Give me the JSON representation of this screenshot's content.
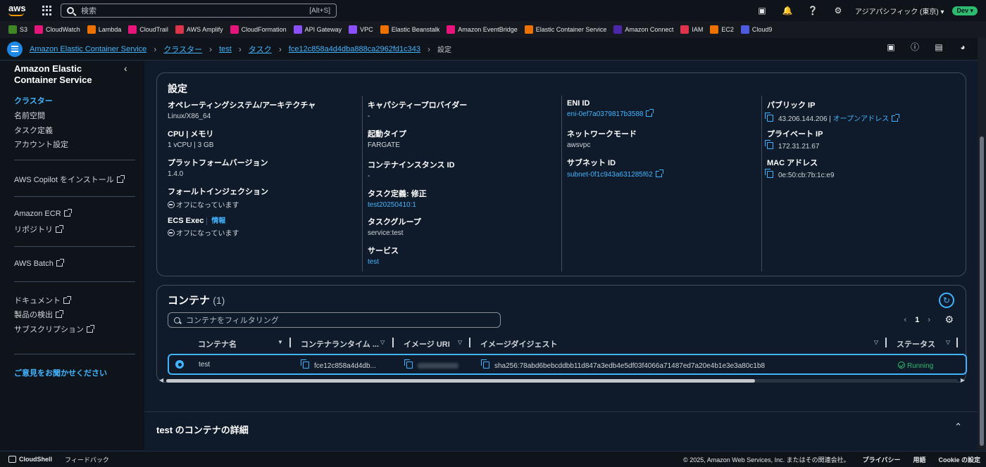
{
  "topnav": {
    "search_placeholder": "検索",
    "search_shortcut": "[Alt+S]",
    "region": "アジアパシフィック (東京) ▾",
    "account_badge": "Dev ▾"
  },
  "favorites": [
    {
      "label": "S3",
      "color": "#3f8624"
    },
    {
      "label": "CloudWatch",
      "color": "#e7157b"
    },
    {
      "label": "Lambda",
      "color": "#ed7100"
    },
    {
      "label": "CloudTrail",
      "color": "#e7157b"
    },
    {
      "label": "AWS Amplify",
      "color": "#dd344c"
    },
    {
      "label": "CloudFormation",
      "color": "#e7157b"
    },
    {
      "label": "API Gateway",
      "color": "#8c4fff"
    },
    {
      "label": "VPC",
      "color": "#8c4fff"
    },
    {
      "label": "Elastic Beanstalk",
      "color": "#ed7100"
    },
    {
      "label": "Amazon EventBridge",
      "color": "#e7157b"
    },
    {
      "label": "Elastic Container Service",
      "color": "#ed7100"
    },
    {
      "label": "Amazon Connect",
      "color": "#4d27aa"
    },
    {
      "label": "IAM",
      "color": "#dd344c"
    },
    {
      "label": "EC2",
      "color": "#ed7100"
    },
    {
      "label": "Cloud9",
      "color": "#4d5bde"
    }
  ],
  "breadcrumb": {
    "items": [
      "Amazon Elastic Container Service",
      "クラスター",
      "test",
      "タスク",
      "fce12c858a4d4dba888ca2962fd1c343"
    ],
    "current": "設定"
  },
  "sidebar": {
    "title": "Amazon Elastic Container Service",
    "nav": [
      "クラスター",
      "名前空間",
      "タスク定義",
      "アカウント設定"
    ],
    "copilot": "AWS Copilot をインストール",
    "ecr": "Amazon ECR",
    "repo": "リポジトリ",
    "batch": "AWS Batch",
    "docs": "ドキュメント",
    "products": "製品の検出",
    "subscriptions": "サブスクリプション",
    "feedback": "ご意見をお聞かせください"
  },
  "settings": {
    "title": "設定",
    "os_label": "オペレーティングシステム/アーキテクチャ",
    "os_value": "Linux/X86_64",
    "cpu_label": "CPU | メモリ",
    "cpu_value": "1 vCPU | 3 GB",
    "platform_label": "プラットフォームバージョン",
    "platform_value": "1.4.0",
    "fault_label": "フォールトインジェクション",
    "fault_value": "オフになっています",
    "ecs_exec_label": "ECS Exec",
    "ecs_exec_info": "情報",
    "ecs_exec_value": "オフになっています",
    "capacity_label": "キャパシティープロバイダー",
    "capacity_value": "-",
    "launch_label": "起動タイプ",
    "launch_value": "FARGATE",
    "instance_label": "コンテナインスタンス ID",
    "instance_value": "-",
    "taskdef_label": "タスク定義: 修正",
    "taskdef_value": "test20250410:1",
    "group_label": "タスクグループ",
    "group_value": "service:test",
    "service_label": "サービス",
    "service_value": "test",
    "eni_label": "ENI ID",
    "eni_value": "eni-0ef7a0379817b3588",
    "netmode_label": "ネットワークモード",
    "netmode_value": "awsvpc",
    "subnet_label": "サブネット ID",
    "subnet_value": "subnet-0f1c943a631285f62",
    "public_ip_label": "パブリック IP",
    "public_ip_value": "43.206.144.206",
    "open_address": "オープンアドレス",
    "private_ip_label": "プライベート IP",
    "private_ip_value": "172.31.21.67",
    "mac_label": "MAC アドレス",
    "mac_value": "0e:50:cb:7b:1c:e9"
  },
  "containers": {
    "title": "コンテナ",
    "count": "(1)",
    "filter_placeholder": "コンテナをフィルタリング",
    "page": "1",
    "columns": [
      "コンテナ名",
      "コンテナランタイム ...",
      "イメージ URI",
      "イメージダイジェスト",
      "ステータス"
    ],
    "row": {
      "name": "test",
      "runtime": "fce12c858a4d4db...",
      "digest": "sha256:78abd6bebcddbb11d847a3edb4e5df03f4066a71487ed7a20e4b1e3e3a80c1b8",
      "status": "Running"
    }
  },
  "details": {
    "title": "test のコンテナの詳細"
  },
  "footer": {
    "cloudshell": "CloudShell",
    "feedback": "フィードバック",
    "copyright": "© 2025, Amazon Web Services, Inc. またはその関連会社。",
    "privacy": "プライバシー",
    "terms": "用語",
    "cookies": "Cookie の設定"
  }
}
